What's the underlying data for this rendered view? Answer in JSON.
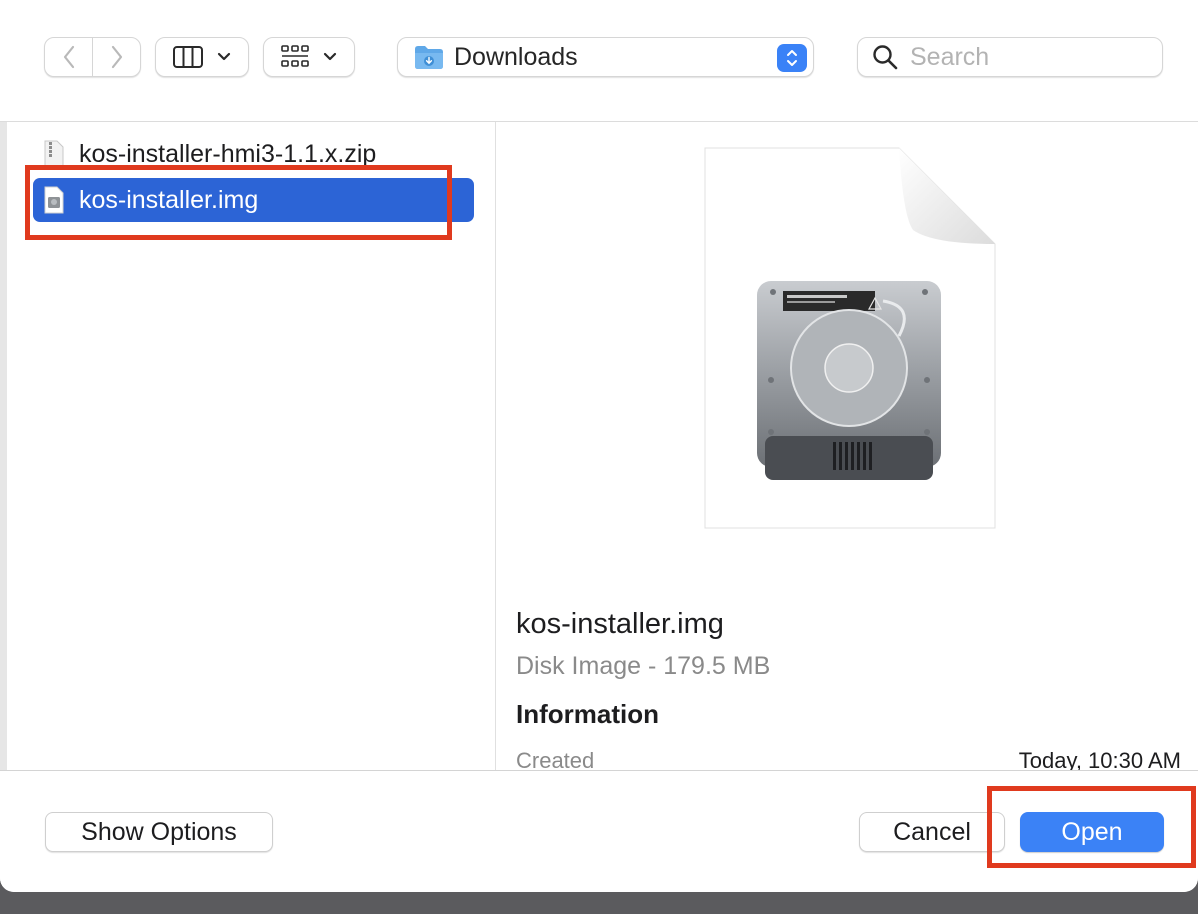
{
  "toolbar": {
    "location": {
      "label": "Downloads",
      "icon": "downloads-folder-icon"
    },
    "search": {
      "placeholder": "Search",
      "value": ""
    },
    "icons": [
      "chevron-left-icon",
      "chevron-right-icon",
      "column-view-icon",
      "chevron-down-icon",
      "group-grid-icon",
      "chevron-down-icon",
      "stepper-icon",
      "search-icon"
    ]
  },
  "files": [
    {
      "name": "kos-installer-hmi3-1.1.x.zip",
      "icon": "zip-file-icon",
      "selected": false
    },
    {
      "name": "kos-installer.img",
      "icon": "disk-image-file-icon",
      "selected": true
    }
  ],
  "preview": {
    "name": "kos-installer.img",
    "kind": "Disk Image - 179.5 MB",
    "info_heading": "Information",
    "created_label": "Created",
    "created_value": "Today, 10:30 AM",
    "icon": "hard-disk-image-icon"
  },
  "buttons": {
    "show_options": "Show Options",
    "cancel": "Cancel",
    "open": "Open"
  },
  "colors": {
    "selection": "#2c64d6",
    "accent": "#3b82f6",
    "annotation": "#e03a1e"
  }
}
